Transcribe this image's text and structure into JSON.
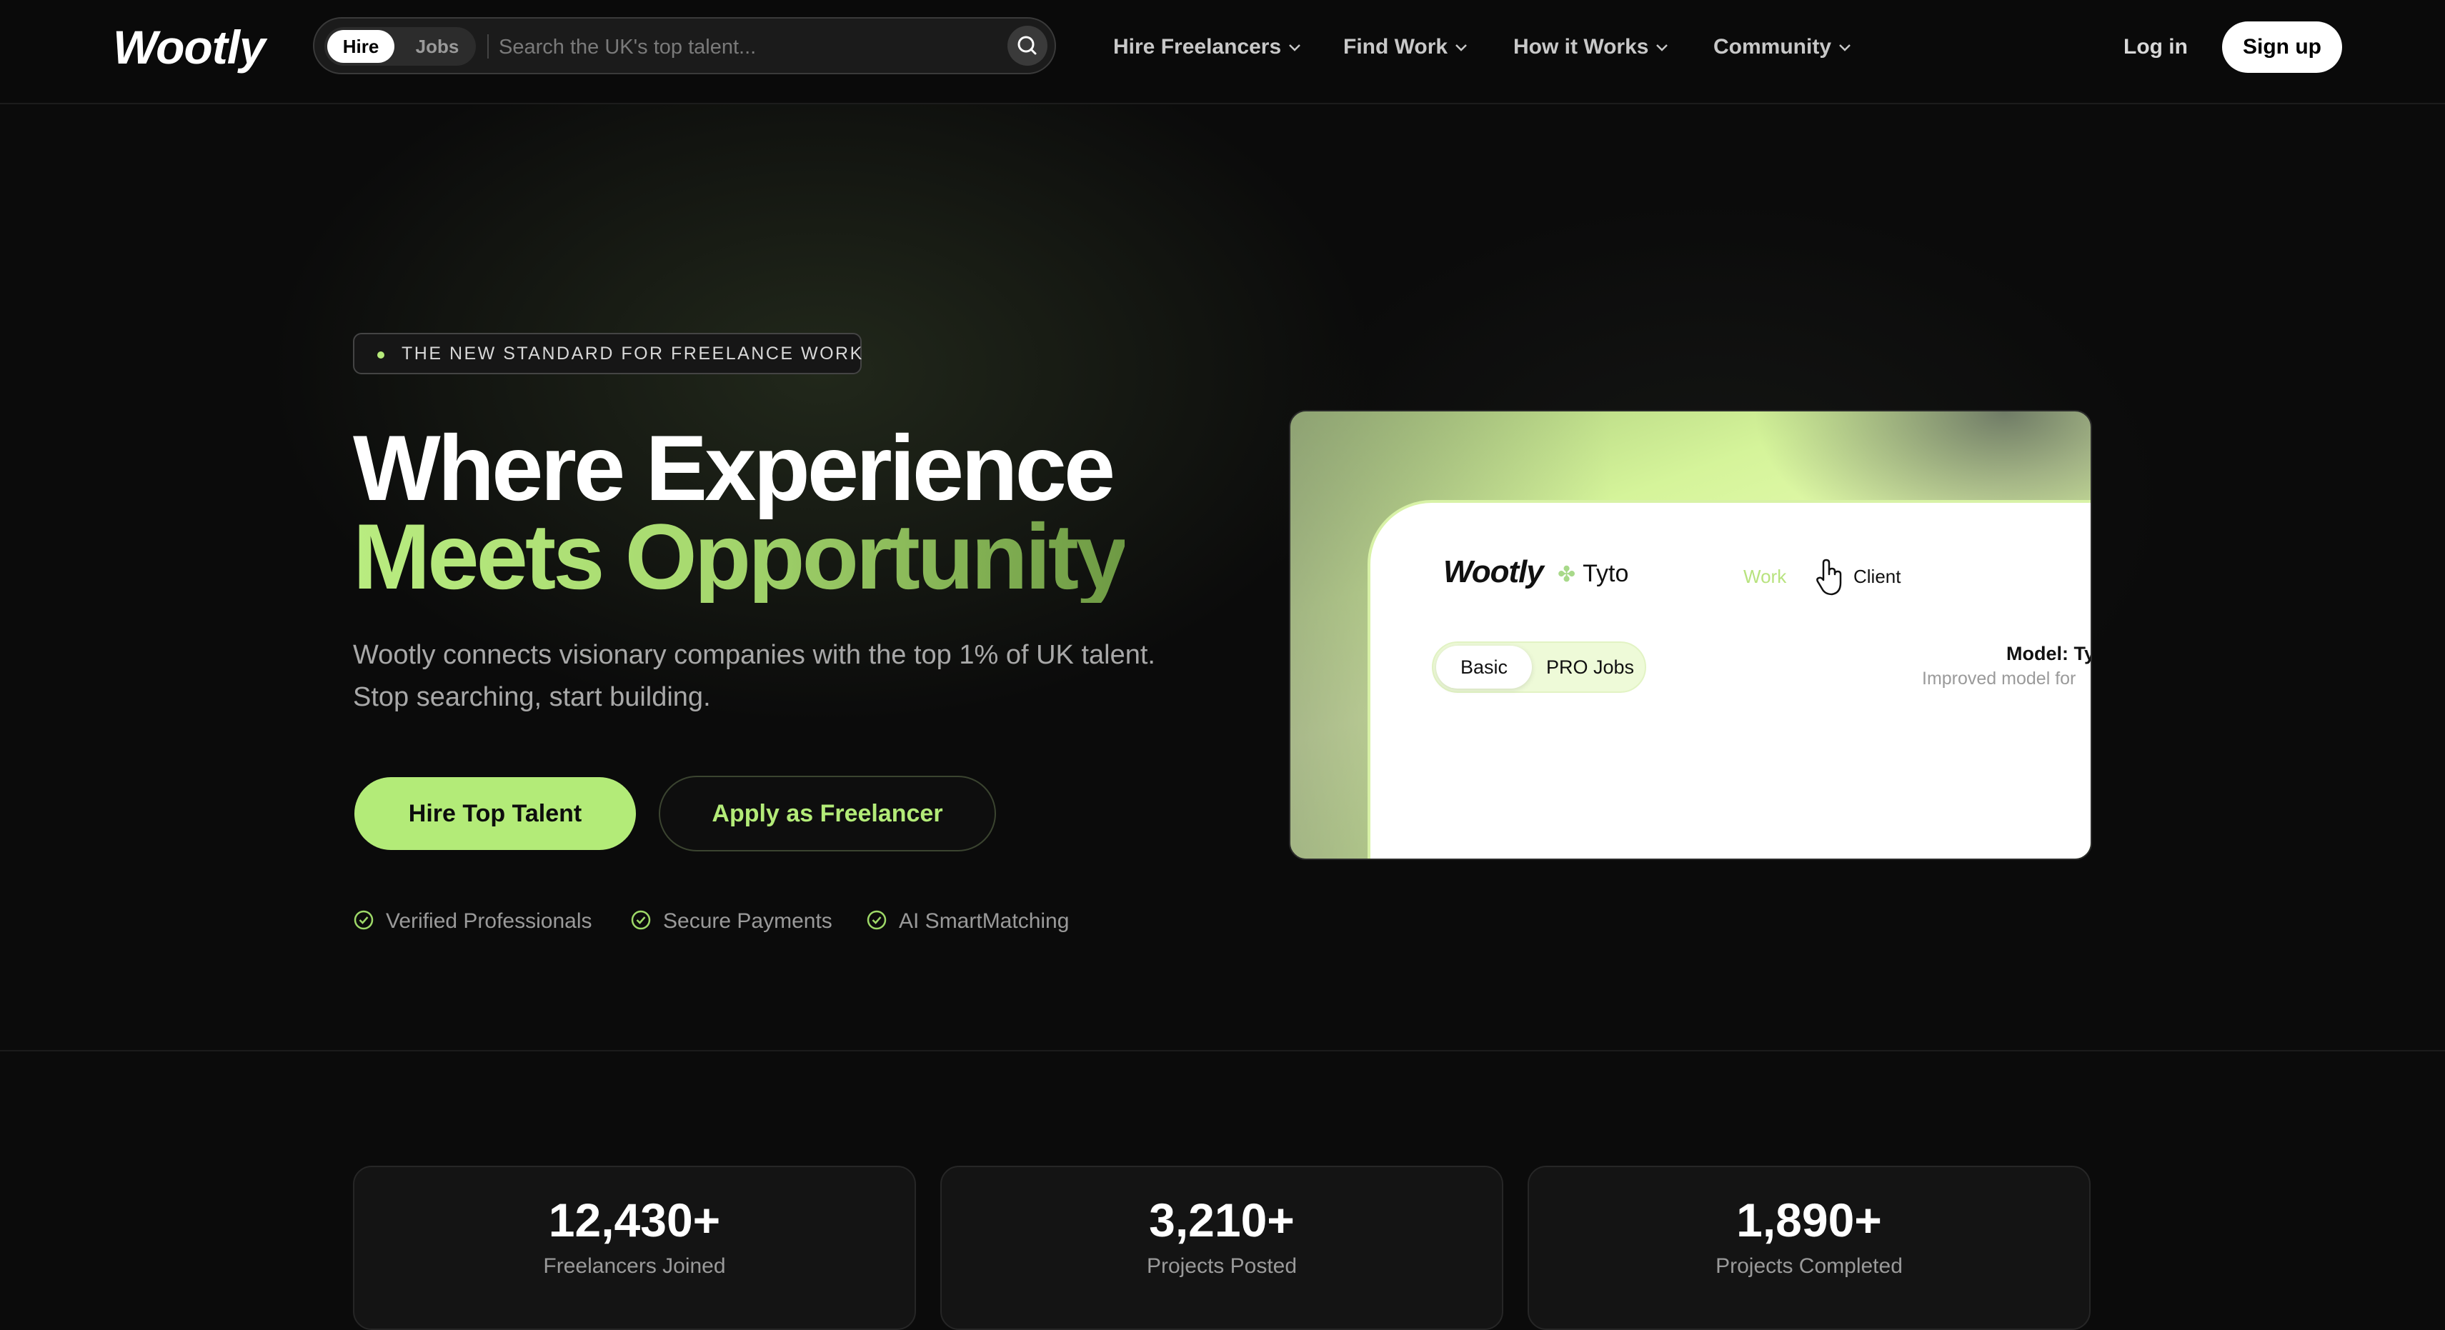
{
  "brand": {
    "name": "Wootly"
  },
  "search": {
    "mode_hire": "Hire",
    "mode_jobs": "Jobs",
    "placeholder": "Search the UK's top talent..."
  },
  "nav": {
    "items": [
      {
        "label": "Hire Freelancers"
      },
      {
        "label": "Find Work"
      },
      {
        "label": "How it Works"
      },
      {
        "label": "Community"
      }
    ],
    "login": "Log in",
    "signup": "Sign up"
  },
  "hero": {
    "badge": "THE NEW STANDARD FOR FREELANCE WORK",
    "title_line1": "Where Experience",
    "title_line2": "Meets Opportunity",
    "subtitle_line1": "Wootly connects visionary companies with the top 1% of UK talent.",
    "subtitle_line2": "Stop searching, start building.",
    "cta_primary": "Hire Top Talent",
    "cta_secondary": "Apply as Freelancer",
    "features": [
      "Verified Professionals",
      "Secure Payments",
      "AI SmartMatching"
    ]
  },
  "preview": {
    "logo": "Wootly",
    "tyto": "Tyto",
    "tab_work": "Work",
    "tab_client": "Client",
    "toggle_basic": "Basic",
    "toggle_pro": "PRO Jobs",
    "model_label": "Model: Ty",
    "model_desc": "Improved model for"
  },
  "stats": [
    {
      "value": "12,430+",
      "label": "Freelancers Joined"
    },
    {
      "value": "3,210+",
      "label": "Projects Posted"
    },
    {
      "value": "1,890+",
      "label": "Projects Completed"
    }
  ],
  "colors": {
    "background": "#0b0b0b",
    "accent": "#b3eb78",
    "accent_dark": "#6e9a44"
  }
}
